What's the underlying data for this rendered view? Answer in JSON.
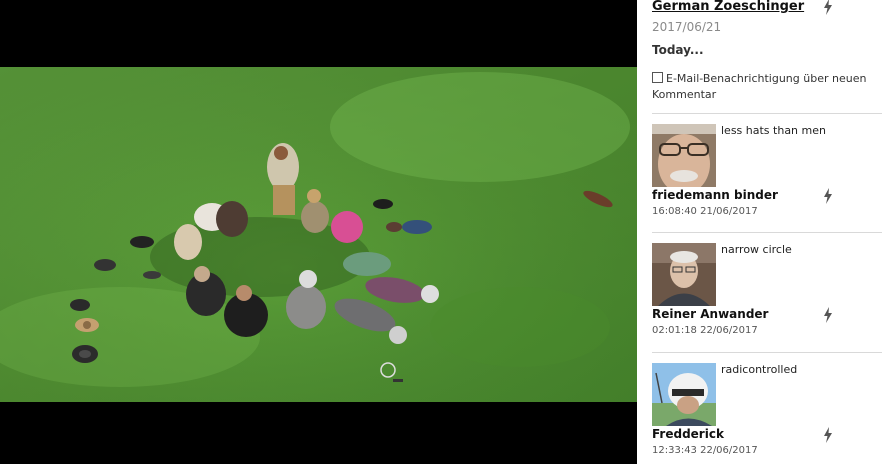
{
  "post": {
    "author": "German Zoeschinger",
    "date": "2017/06/21",
    "title": "Today...",
    "notify_label": "E-Mail-Benachrichtigung über neuen Kommentar"
  },
  "comments": [
    {
      "text": "less hats than men",
      "author": "friedemann binder",
      "timestamp": "16:08:40 21/06/2017"
    },
    {
      "text": "narrow circle",
      "author": "Reiner Anwander",
      "timestamp": "02:01:18 22/06/2017"
    },
    {
      "text": "radicontrolled",
      "author": "Fredderick",
      "timestamp": "12:33:43 22/06/2017"
    }
  ],
  "colors": {
    "letterbox": "#000000",
    "grass": "#5aa23a",
    "panel_bg": "#ffffff",
    "divider": "#d9d9d9"
  },
  "icons": {
    "flash": "lightning-bolt-icon",
    "checkbox": "checkbox-unchecked-icon"
  }
}
